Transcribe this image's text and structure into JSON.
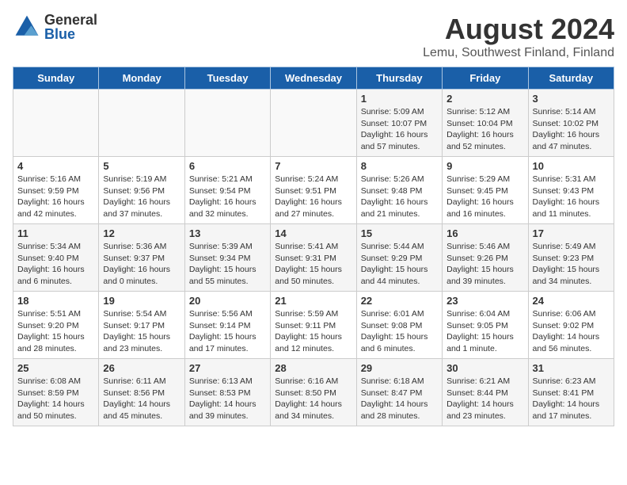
{
  "logo": {
    "general": "General",
    "blue": "Blue"
  },
  "title": "August 2024",
  "subtitle": "Lemu, Southwest Finland, Finland",
  "days_of_week": [
    "Sunday",
    "Monday",
    "Tuesday",
    "Wednesday",
    "Thursday",
    "Friday",
    "Saturday"
  ],
  "weeks": [
    [
      {
        "day": "",
        "info": ""
      },
      {
        "day": "",
        "info": ""
      },
      {
        "day": "",
        "info": ""
      },
      {
        "day": "",
        "info": ""
      },
      {
        "day": "1",
        "info": "Sunrise: 5:09 AM\nSunset: 10:07 PM\nDaylight: 16 hours\nand 57 minutes."
      },
      {
        "day": "2",
        "info": "Sunrise: 5:12 AM\nSunset: 10:04 PM\nDaylight: 16 hours\nand 52 minutes."
      },
      {
        "day": "3",
        "info": "Sunrise: 5:14 AM\nSunset: 10:02 PM\nDaylight: 16 hours\nand 47 minutes."
      }
    ],
    [
      {
        "day": "4",
        "info": "Sunrise: 5:16 AM\nSunset: 9:59 PM\nDaylight: 16 hours\nand 42 minutes."
      },
      {
        "day": "5",
        "info": "Sunrise: 5:19 AM\nSunset: 9:56 PM\nDaylight: 16 hours\nand 37 minutes."
      },
      {
        "day": "6",
        "info": "Sunrise: 5:21 AM\nSunset: 9:54 PM\nDaylight: 16 hours\nand 32 minutes."
      },
      {
        "day": "7",
        "info": "Sunrise: 5:24 AM\nSunset: 9:51 PM\nDaylight: 16 hours\nand 27 minutes."
      },
      {
        "day": "8",
        "info": "Sunrise: 5:26 AM\nSunset: 9:48 PM\nDaylight: 16 hours\nand 21 minutes."
      },
      {
        "day": "9",
        "info": "Sunrise: 5:29 AM\nSunset: 9:45 PM\nDaylight: 16 hours\nand 16 minutes."
      },
      {
        "day": "10",
        "info": "Sunrise: 5:31 AM\nSunset: 9:43 PM\nDaylight: 16 hours\nand 11 minutes."
      }
    ],
    [
      {
        "day": "11",
        "info": "Sunrise: 5:34 AM\nSunset: 9:40 PM\nDaylight: 16 hours\nand 6 minutes."
      },
      {
        "day": "12",
        "info": "Sunrise: 5:36 AM\nSunset: 9:37 PM\nDaylight: 16 hours\nand 0 minutes."
      },
      {
        "day": "13",
        "info": "Sunrise: 5:39 AM\nSunset: 9:34 PM\nDaylight: 15 hours\nand 55 minutes."
      },
      {
        "day": "14",
        "info": "Sunrise: 5:41 AM\nSunset: 9:31 PM\nDaylight: 15 hours\nand 50 minutes."
      },
      {
        "day": "15",
        "info": "Sunrise: 5:44 AM\nSunset: 9:29 PM\nDaylight: 15 hours\nand 44 minutes."
      },
      {
        "day": "16",
        "info": "Sunrise: 5:46 AM\nSunset: 9:26 PM\nDaylight: 15 hours\nand 39 minutes."
      },
      {
        "day": "17",
        "info": "Sunrise: 5:49 AM\nSunset: 9:23 PM\nDaylight: 15 hours\nand 34 minutes."
      }
    ],
    [
      {
        "day": "18",
        "info": "Sunrise: 5:51 AM\nSunset: 9:20 PM\nDaylight: 15 hours\nand 28 minutes."
      },
      {
        "day": "19",
        "info": "Sunrise: 5:54 AM\nSunset: 9:17 PM\nDaylight: 15 hours\nand 23 minutes."
      },
      {
        "day": "20",
        "info": "Sunrise: 5:56 AM\nSunset: 9:14 PM\nDaylight: 15 hours\nand 17 minutes."
      },
      {
        "day": "21",
        "info": "Sunrise: 5:59 AM\nSunset: 9:11 PM\nDaylight: 15 hours\nand 12 minutes."
      },
      {
        "day": "22",
        "info": "Sunrise: 6:01 AM\nSunset: 9:08 PM\nDaylight: 15 hours\nand 6 minutes."
      },
      {
        "day": "23",
        "info": "Sunrise: 6:04 AM\nSunset: 9:05 PM\nDaylight: 15 hours\nand 1 minute."
      },
      {
        "day": "24",
        "info": "Sunrise: 6:06 AM\nSunset: 9:02 PM\nDaylight: 14 hours\nand 56 minutes."
      }
    ],
    [
      {
        "day": "25",
        "info": "Sunrise: 6:08 AM\nSunset: 8:59 PM\nDaylight: 14 hours\nand 50 minutes."
      },
      {
        "day": "26",
        "info": "Sunrise: 6:11 AM\nSunset: 8:56 PM\nDaylight: 14 hours\nand 45 minutes."
      },
      {
        "day": "27",
        "info": "Sunrise: 6:13 AM\nSunset: 8:53 PM\nDaylight: 14 hours\nand 39 minutes."
      },
      {
        "day": "28",
        "info": "Sunrise: 6:16 AM\nSunset: 8:50 PM\nDaylight: 14 hours\nand 34 minutes."
      },
      {
        "day": "29",
        "info": "Sunrise: 6:18 AM\nSunset: 8:47 PM\nDaylight: 14 hours\nand 28 minutes."
      },
      {
        "day": "30",
        "info": "Sunrise: 6:21 AM\nSunset: 8:44 PM\nDaylight: 14 hours\nand 23 minutes."
      },
      {
        "day": "31",
        "info": "Sunrise: 6:23 AM\nSunset: 8:41 PM\nDaylight: 14 hours\nand 17 minutes."
      }
    ]
  ]
}
